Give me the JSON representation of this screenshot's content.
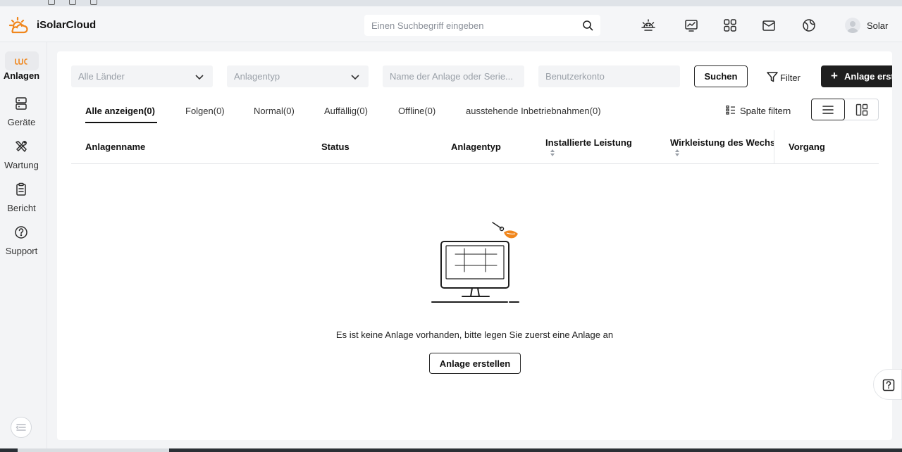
{
  "header": {
    "brand": "iSolarCloud",
    "search_placeholder": "Einen Suchbegriff eingeben",
    "user_name": "Solar"
  },
  "sidebar": {
    "items": [
      {
        "label": "Anlagen",
        "icon": "plant-icon",
        "active": true
      },
      {
        "label": "Geräte",
        "icon": "devices-icon",
        "active": false
      },
      {
        "label": "Wartung",
        "icon": "maintenance-icon",
        "active": false
      },
      {
        "label": "Bericht",
        "icon": "report-icon",
        "active": false
      },
      {
        "label": "Support",
        "icon": "support-icon",
        "active": false
      }
    ]
  },
  "filters": {
    "country_placeholder": "Alle Länder",
    "plant_type_placeholder": "Anlagentyp",
    "plant_name_placeholder": "Name der Anlage oder Serie...",
    "user_account_placeholder": "Benutzerkonto",
    "search_button": "Suchen",
    "filter_button": "Filter",
    "create_button": "Anlage erst"
  },
  "tabs": [
    {
      "label": "Alle anzeigen(0)",
      "active": true
    },
    {
      "label": "Folgen(0)",
      "active": false
    },
    {
      "label": "Normal(0)",
      "active": false
    },
    {
      "label": "Auffällig(0)",
      "active": false
    },
    {
      "label": "Offline(0)",
      "active": false
    },
    {
      "label": "ausstehende Inbetriebnahmen(0)",
      "active": false
    }
  ],
  "column_filter_label": "Spalte filtern",
  "table": {
    "columns": [
      {
        "label": "Anlagenname"
      },
      {
        "label": "Status"
      },
      {
        "label": "Anlagentyp"
      },
      {
        "label": "Installierte Leistung"
      },
      {
        "label": "Wirkleistung des Wechs"
      },
      {
        "label": "Vorgang"
      }
    ]
  },
  "empty_state": {
    "message": "Es ist keine Anlage vorhanden, bitte legen Sie zuerst eine Anlage an",
    "create_button": "Anlage erstellen"
  },
  "colors": {
    "accent_orange": "#f0861c",
    "dark_button": "#1f1f1f"
  }
}
